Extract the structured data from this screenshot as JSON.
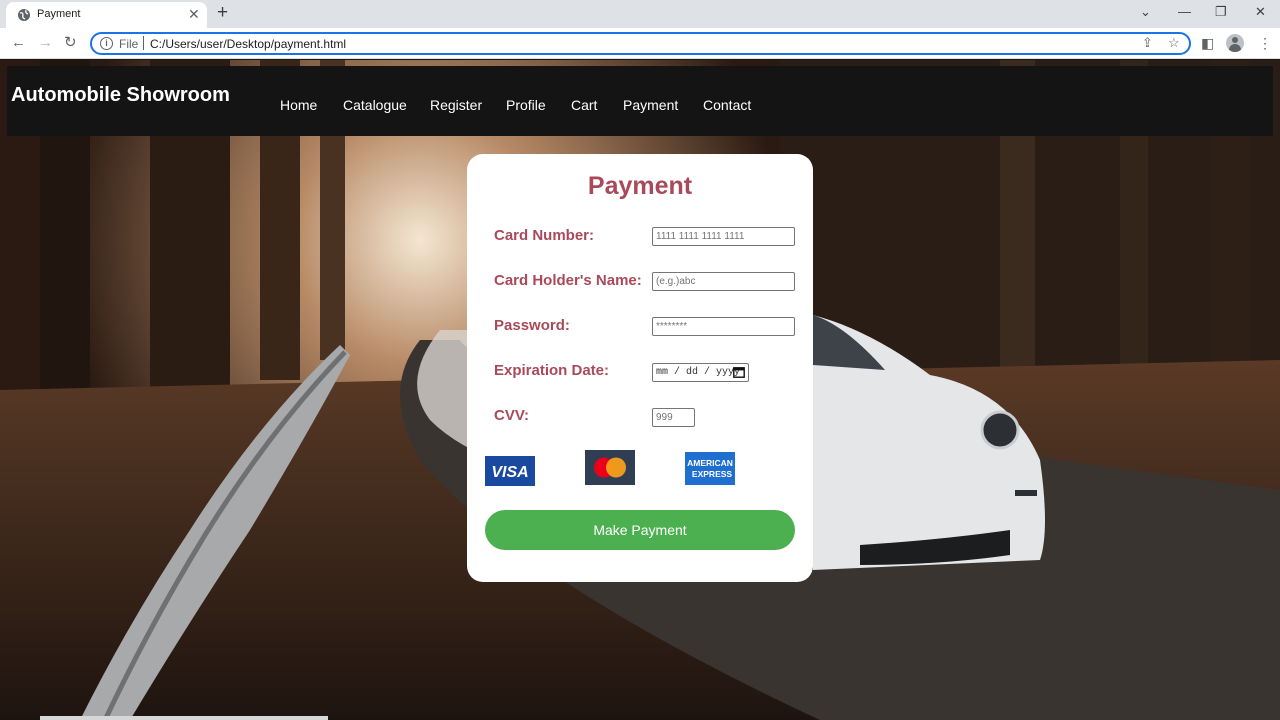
{
  "browser": {
    "tab": {
      "title": "Payment",
      "close_symbol": "✕"
    },
    "new_tab_symbol": "+",
    "window_controls": {
      "tabsearch": "⌄",
      "minimize": "—",
      "restore": "❐",
      "close": "✕"
    },
    "nav": {
      "back": "←",
      "forward": "→",
      "reload": "↻"
    },
    "address": {
      "scheme": "File",
      "url": "C:/Users/user/Desktop/payment.html",
      "info_symbol": "i"
    },
    "icons": {
      "share": "⇪",
      "bookmark": "☆",
      "sidepanel": "◧",
      "menu": "⋮"
    }
  },
  "header": {
    "brand": "Automobile Showroom",
    "nav": [
      "Home",
      "Catalogue",
      "Register",
      "Profile",
      "Cart",
      "Payment",
      "Contact"
    ]
  },
  "form": {
    "title": "Payment",
    "labels": {
      "card_number": "Card Number:",
      "holder": "Card Holder's Name:",
      "password": "Password:",
      "expiry": "Expiration Date:",
      "cvv": "CVV:"
    },
    "placeholders": {
      "card_number": "1111 1111 1111 1111",
      "holder": "(e.g.)abc",
      "password": "********",
      "cvv": "999"
    },
    "expiry_format": "mm / dd / yyyy",
    "logos": {
      "visa": "VISA",
      "amex_line1": "AMERICAN",
      "amex_line2": "EXPRESS"
    },
    "submit": "Make Payment"
  },
  "colors": {
    "accent": "#a94a5a",
    "button": "#4caf50",
    "header_bg": "#141414",
    "focus": "#1a73e8"
  }
}
